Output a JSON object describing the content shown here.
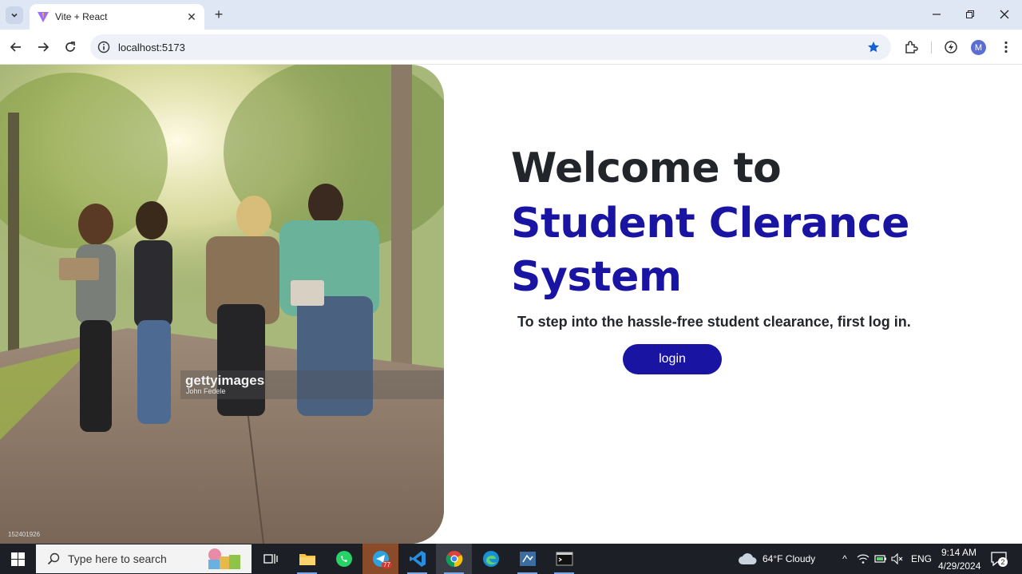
{
  "browser": {
    "tab_title": "Vite + React",
    "url": "localhost:5173",
    "profile_initial": "M"
  },
  "page": {
    "welcome": "Welcome to",
    "system_name": "Student Clerance System",
    "subtitle": "To step into the hassle-free student clearance, first log in.",
    "login_label": "login",
    "image": {
      "watermark_logo": "gettyimages",
      "watermark_credit": "John Fedele",
      "image_id": "152401926"
    }
  },
  "taskbar": {
    "search_placeholder": "Type here to search",
    "telegram_badge": "77",
    "weather": "64°F  Cloudy",
    "language": "ENG",
    "time": "9:14 AM",
    "date": "4/29/2024",
    "notification_count": "2"
  },
  "colors": {
    "heading_dark": "#22262b",
    "accent_blue": "#1a14a3",
    "taskbar": "#1c1f26"
  }
}
